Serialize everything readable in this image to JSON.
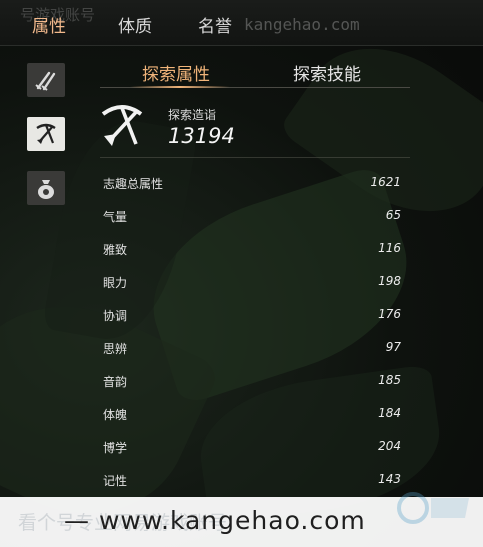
{
  "top_tabs": {
    "attributes": "属性",
    "constitution": "体质",
    "reputation": "名誉"
  },
  "watermarks": {
    "top_url": "kangehao.com",
    "top_cn": "号游戏账号",
    "bottom_cn": "看个号专业网易游戏账号",
    "bottom_url": "www.kangehao.com"
  },
  "side_icons": [
    {
      "icon": "weapons-icon"
    },
    {
      "icon": "pickaxe-shovel-icon",
      "selected": true
    },
    {
      "icon": "coin-bag-icon"
    }
  ],
  "section_tabs": {
    "active": "探索属性",
    "inactive": "探索技能"
  },
  "header": {
    "label": "探索造诣",
    "value": "13194"
  },
  "attributes": [
    {
      "label": "志趣总属性",
      "value": "1621"
    },
    {
      "label": "气量",
      "value": "65"
    },
    {
      "label": "雅致",
      "value": "116"
    },
    {
      "label": "眼力",
      "value": "198"
    },
    {
      "label": "协调",
      "value": "176"
    },
    {
      "label": "思辨",
      "value": "97"
    },
    {
      "label": "音韵",
      "value": "185"
    },
    {
      "label": "体魄",
      "value": "184"
    },
    {
      "label": "博学",
      "value": "204"
    },
    {
      "label": "记性",
      "value": "143"
    }
  ],
  "colors": {
    "accent": "#f0b47a",
    "text": "#e2e2e2"
  }
}
